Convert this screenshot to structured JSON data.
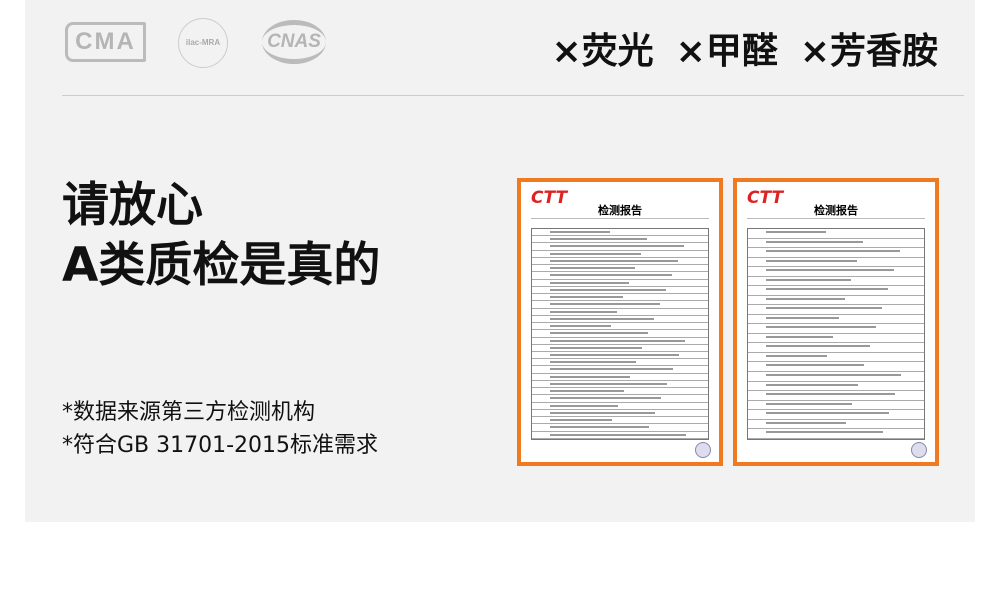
{
  "logos": [
    "CMA",
    "ilac-MRA",
    "CNAS"
  ],
  "claims": [
    "×荧光",
    "×甲醛",
    "×芳香胺"
  ],
  "headline": [
    "请放心",
    "A类质检是真的"
  ],
  "notes": [
    "*数据来源第三方检测机构",
    "*符合GB 31701-2015标准需求"
  ],
  "documents": [
    {
      "brand": "CTT",
      "title": "检测报告",
      "rows": 29
    },
    {
      "brand": "CTT",
      "title": "检测报告",
      "rows": 22
    }
  ],
  "colors": {
    "accent": "#f07a1f",
    "panel": "#f2f2f2"
  }
}
